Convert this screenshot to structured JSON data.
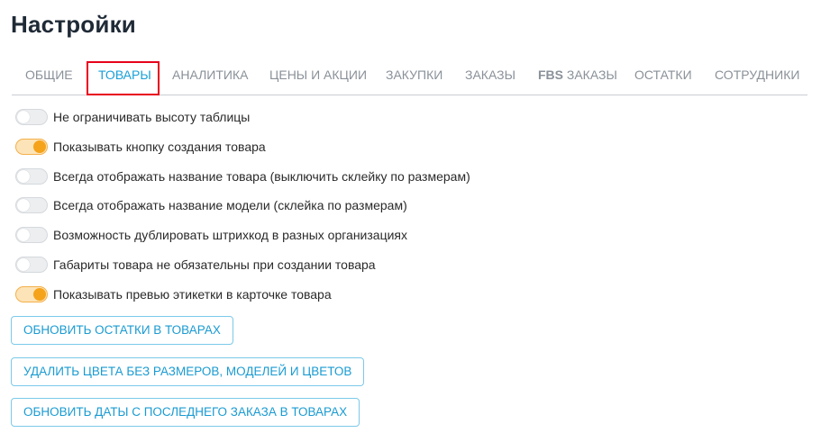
{
  "page": {
    "title": "Настройки"
  },
  "tabs": [
    {
      "label": "ОБЩИЕ",
      "active": false
    },
    {
      "label": "ТОВАРЫ",
      "active": true
    },
    {
      "label": "АНАЛИТИКА",
      "active": false
    },
    {
      "label": "ЦЕНЫ И АКЦИИ",
      "active": false
    },
    {
      "label": "ЗАКУПКИ",
      "active": false
    },
    {
      "label": "ЗАКАЗЫ",
      "active": false
    },
    {
      "label_prefix": "FBS",
      "label_suffix": " ЗАКАЗЫ",
      "active": false
    },
    {
      "label": "ОСТАТКИ",
      "active": false
    },
    {
      "label": "СОТРУДНИКИ",
      "active": false
    }
  ],
  "toggles": [
    {
      "label": "Не ограничивать высоту таблицы",
      "checked": false
    },
    {
      "label": "Показывать кнопку создания товара",
      "checked": true
    },
    {
      "label": "Всегда отображать название товара (выключить склейку по размерам)",
      "checked": false
    },
    {
      "label": "Всегда отображать название модели (склейка по размерам)",
      "checked": false
    },
    {
      "label": "Возможность дублировать штрихкод в разных организациях",
      "checked": false
    },
    {
      "label": "Габариты товара не обязательны при создании товара",
      "checked": false
    },
    {
      "label": "Показывать превью этикетки в карточке товара",
      "checked": true
    }
  ],
  "buttons": {
    "update_stock": "ОБНОВИТЬ ОСТАТКИ В ТОВАРАХ",
    "delete_colors": "УДАЛИТЬ ЦВЕТА БЕЗ РАЗМЕРОВ, МОДЕЛЕЙ И ЦВЕТОВ",
    "update_dates": "ОБНОВИТЬ ДАТЫ С ПОСЛЕДНЕГО ЗАКАЗА В ТОВАРАХ"
  },
  "colors": {
    "accent": "#1aa0d8",
    "toggle_on": "#f5a31a",
    "highlight": "#e8001c"
  }
}
